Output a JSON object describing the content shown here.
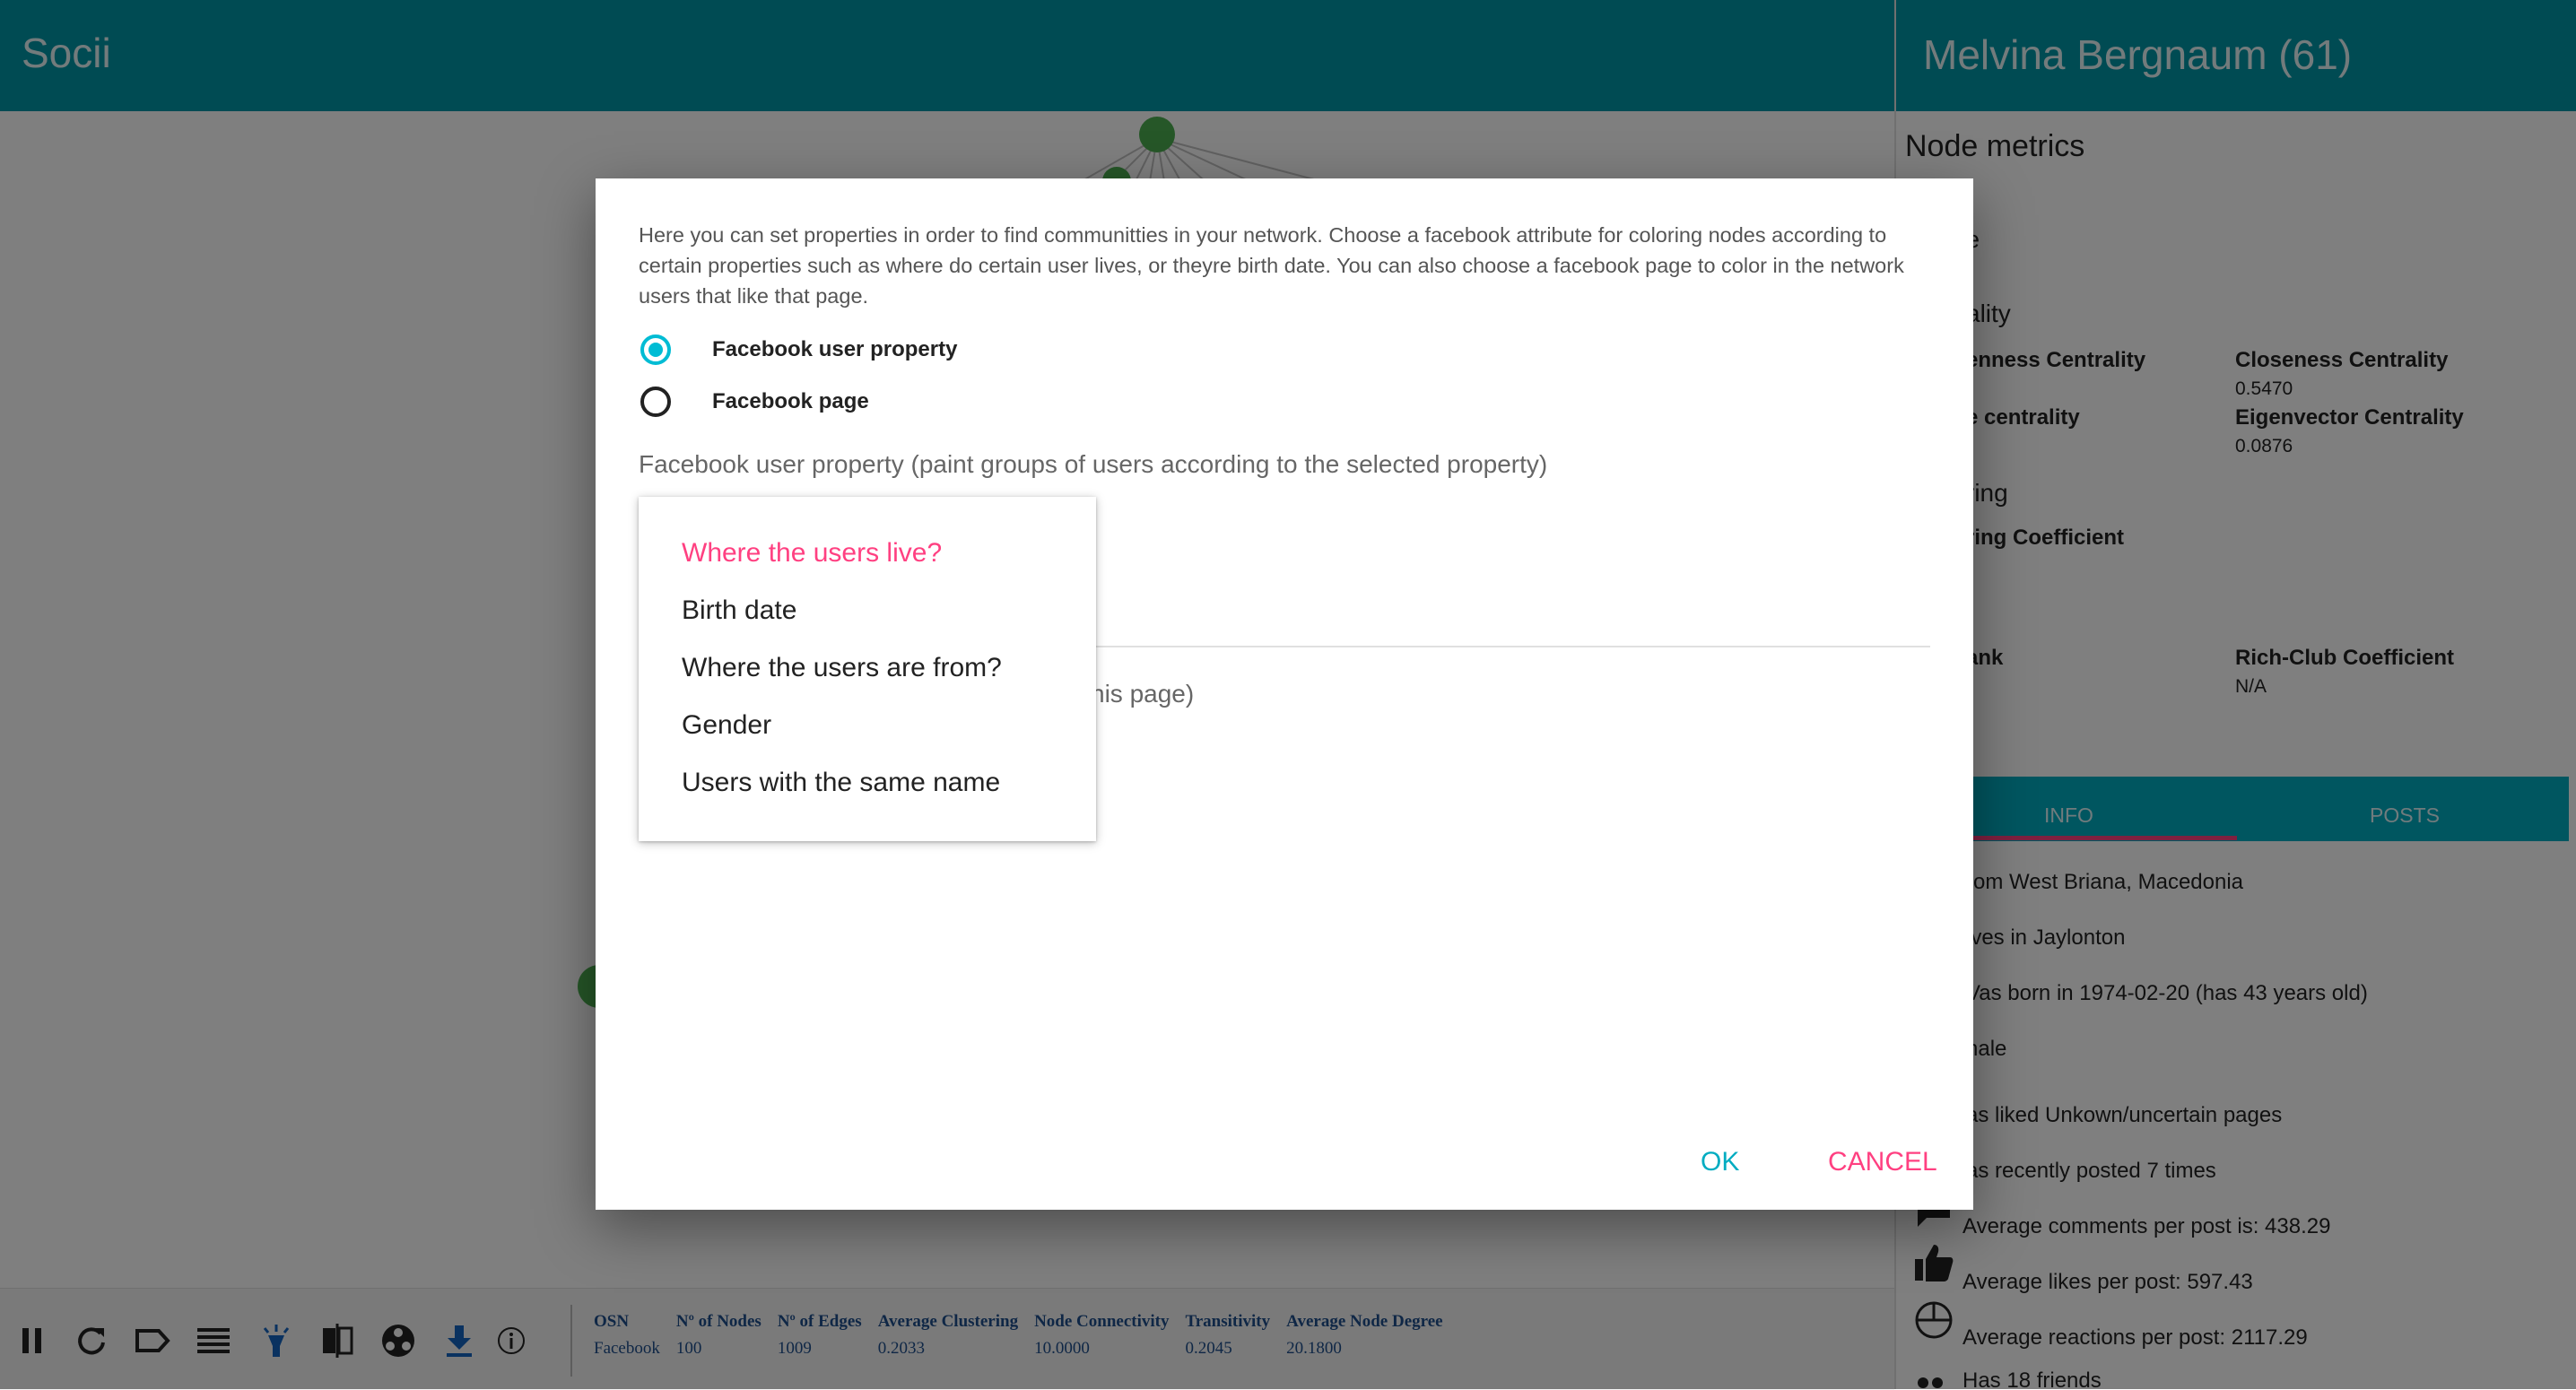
{
  "app": {
    "title": "Socii"
  },
  "toolbar": {
    "icons": [
      "pause-icon",
      "refresh-icon",
      "label-icon",
      "list-icon",
      "highlight-icon",
      "compare-icon",
      "community-icon",
      "download-icon",
      "info-icon"
    ],
    "metrics": [
      {
        "header": "OSN",
        "value": "Facebook"
      },
      {
        "header": "Nº of Nodes",
        "value": "100"
      },
      {
        "header": "Nº of Edges",
        "value": "1009"
      },
      {
        "header": "Average Clustering",
        "value": "0.2033"
      },
      {
        "header": "Node Connectivity",
        "value": "10.0000"
      },
      {
        "header": "Transitivity",
        "value": "0.2045"
      },
      {
        "header": "Average Node Degree",
        "value": "20.1800"
      }
    ]
  },
  "panel": {
    "user_name": "Melvina Bergnaum (61)",
    "section_title": "Node metrics",
    "fragments": {
      "degree_frag": "e",
      "centrality_frag": "ality",
      "betweenness_frag": "enness Centrality",
      "closeness_label": "Closeness Centrality",
      "closeness_value": "0.5470",
      "degree_centrality_frag": "e centrality",
      "eigenvector_label": "Eigenvector Centrality",
      "eigenvector_value": "0.0876",
      "clustering_frag": "ring",
      "clustering_coef_frag": "ring Coefficient",
      "pagerank_frag": "ank",
      "richclub_label": "Rich-Club Coefficient",
      "richclub_value": "N/A"
    },
    "tabs": [
      "INFO",
      "POSTS"
    ],
    "info": [
      "rom West Briana, Macedonia",
      "ives in Jaylonton",
      "Vas born in 1974-02-20 (has 43 years old)",
      "nale",
      "as liked Unkown/uncertain pages",
      "as recently posted 7 times",
      "Average comments per post is: 438.29",
      "Average likes per post: 597.43",
      "Average reactions per post: 2117.29",
      "Has 18 friends"
    ]
  },
  "dialog": {
    "description": "Here you can set properties in order to find communitties in your network. Choose a facebook attribute for coloring nodes according to certain properties such as where do certain user lives, or theyre birth date. You can also choose a facebook page to color in the network users that like that page.",
    "radio_options": [
      {
        "label": "Facebook user property",
        "checked": true
      },
      {
        "label": "Facebook page",
        "checked": false
      }
    ],
    "property_label": "Facebook user property (paint groups of users according to the selected property)",
    "partially_hidden_label": "his page)",
    "dropdown": {
      "selected": "Where the users live?",
      "options": [
        "Where the users live?",
        "Birth date",
        "Where the users are from?",
        "Gender",
        "Users with the same name"
      ]
    },
    "ok_label": "OK",
    "cancel_label": "CANCEL"
  },
  "colors": {
    "primary": "#0097a7",
    "accent": "#ff4081",
    "radio_checked": "#00bcd4",
    "ok_text": "#00acc1",
    "node_green": "#4caf50"
  }
}
